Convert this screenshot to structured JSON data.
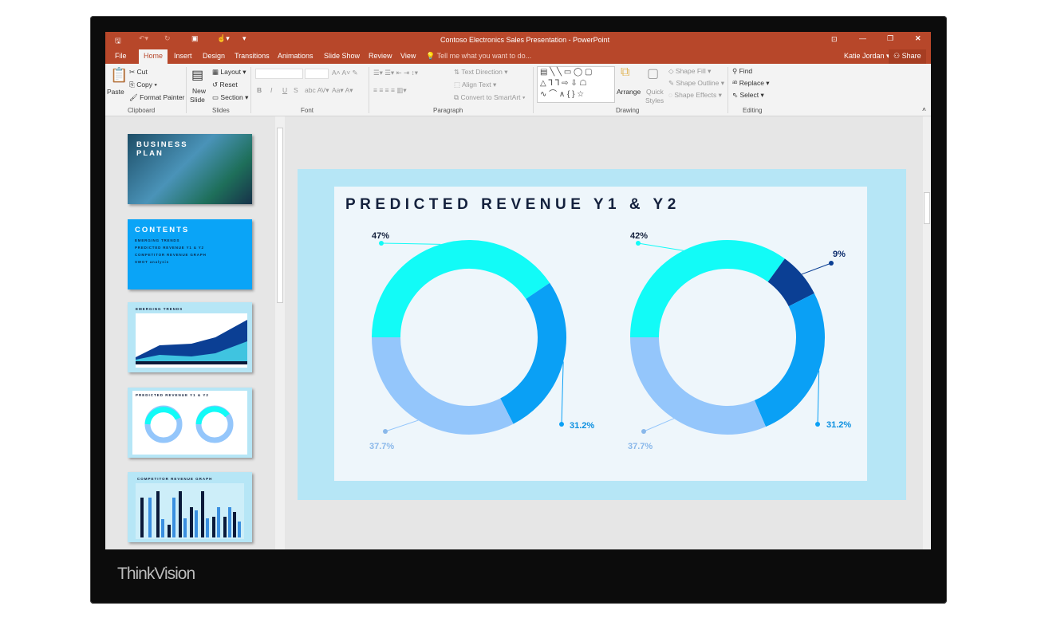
{
  "window": {
    "title": "Contoso Electronics Sales Presentation - PowerPoint",
    "user": "Katie Jordan",
    "share": "Share"
  },
  "tabs": [
    "File",
    "Home",
    "Insert",
    "Design",
    "Transitions",
    "Animations",
    "Slide Show",
    "Review",
    "View"
  ],
  "active_tab": "Home",
  "tell_me": "Tell me what you want to do...",
  "ribbon": {
    "clipboard": {
      "paste": "Paste",
      "cut": "Cut",
      "copy": "Copy",
      "format_painter": "Format Painter",
      "label": "Clipboard"
    },
    "slides": {
      "new_slide": "New",
      "new_slide2": "Slide",
      "layout": "Layout",
      "reset": "Reset",
      "section": "Section",
      "label": "Slides"
    },
    "font": {
      "label": "Font",
      "bold": "B",
      "italic": "I",
      "underline": "U",
      "strike": "S",
      "aa": "Aa"
    },
    "paragraph": {
      "text_direction": "Text Direction",
      "align_text": "Align Text",
      "convert": "Convert to SmartArt",
      "label": "Paragraph"
    },
    "drawing": {
      "arrange": "Arrange",
      "quick_styles": "Quick",
      "quick_styles2": "Styles",
      "shape_fill": "Shape Fill",
      "shape_outline": "Shape Outline",
      "shape_effects": "Shape Effects",
      "label": "Drawing"
    },
    "editing": {
      "find": "Find",
      "replace": "Replace",
      "select": "Select",
      "label": "Editing"
    }
  },
  "thumbnails": [
    {
      "title1": "BUSINESS",
      "title2": "PLAN"
    },
    {
      "title": "CONTENTS",
      "items": [
        "EMERGING TRENDS",
        "PREDICTED REVENUE Y1 & Y2",
        "COMPETITOR REVENUE GRAPH",
        "SWOT analysis"
      ]
    },
    {
      "title": "EMERGING TRENDS"
    },
    {
      "title": "PREDICTED REVENUE Y1 & Y2"
    },
    {
      "title": "COMPETITOR REVENUE GRAPH"
    }
  ],
  "slide": {
    "title": "PREDICTED REVENUE Y1 & Y2"
  },
  "chart_data": [
    {
      "type": "pie",
      "subtype": "donut",
      "slices": [
        {
          "label": "47%",
          "value": 47,
          "color": "#12fbf7"
        },
        {
          "label": "31.2%",
          "value": 31.2,
          "color": "#0aa0f5"
        },
        {
          "label": "37.7%",
          "value": 37.7,
          "color": "#94c6fb"
        }
      ]
    },
    {
      "type": "pie",
      "subtype": "donut",
      "slices": [
        {
          "label": "42%",
          "value": 42,
          "color": "#12fbf7"
        },
        {
          "label": "9%",
          "value": 9,
          "color": "#0b3f94"
        },
        {
          "label": "31.2%",
          "value": 31.2,
          "color": "#0aa0f5"
        },
        {
          "label": "37.7%",
          "value": 37.7,
          "color": "#94c6fb"
        }
      ]
    }
  ],
  "brand": "ThinkVision"
}
